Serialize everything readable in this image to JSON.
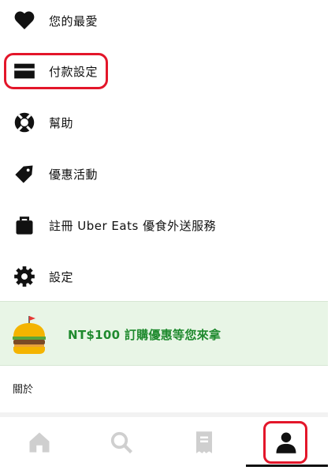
{
  "menu": {
    "favorites": "您的最愛",
    "payment": "付款設定",
    "help": "幫助",
    "promotions": "優惠活動",
    "eats_pass": "註冊 Uber Eats 優食外送服務",
    "settings": "設定"
  },
  "promo": {
    "text": "NT$100 訂購優惠等您來拿"
  },
  "about": "關於",
  "icons": {
    "favorites": "heart-icon",
    "payment": "credit-card-icon",
    "help": "lifebuoy-icon",
    "promotions": "tag-icon",
    "eats_pass": "bag-icon",
    "settings": "gear-icon",
    "promo": "burger-icon",
    "nav_home": "home-icon",
    "nav_search": "search-icon",
    "nav_orders": "receipt-icon",
    "nav_account": "person-icon"
  },
  "colors": {
    "accent_green": "#1f8a2e",
    "promo_bg": "#e8f5e6",
    "highlight_red": "#e3162a",
    "nav_inactive": "#cfcfcf"
  },
  "bottom_nav": {
    "active_tab": "account"
  }
}
